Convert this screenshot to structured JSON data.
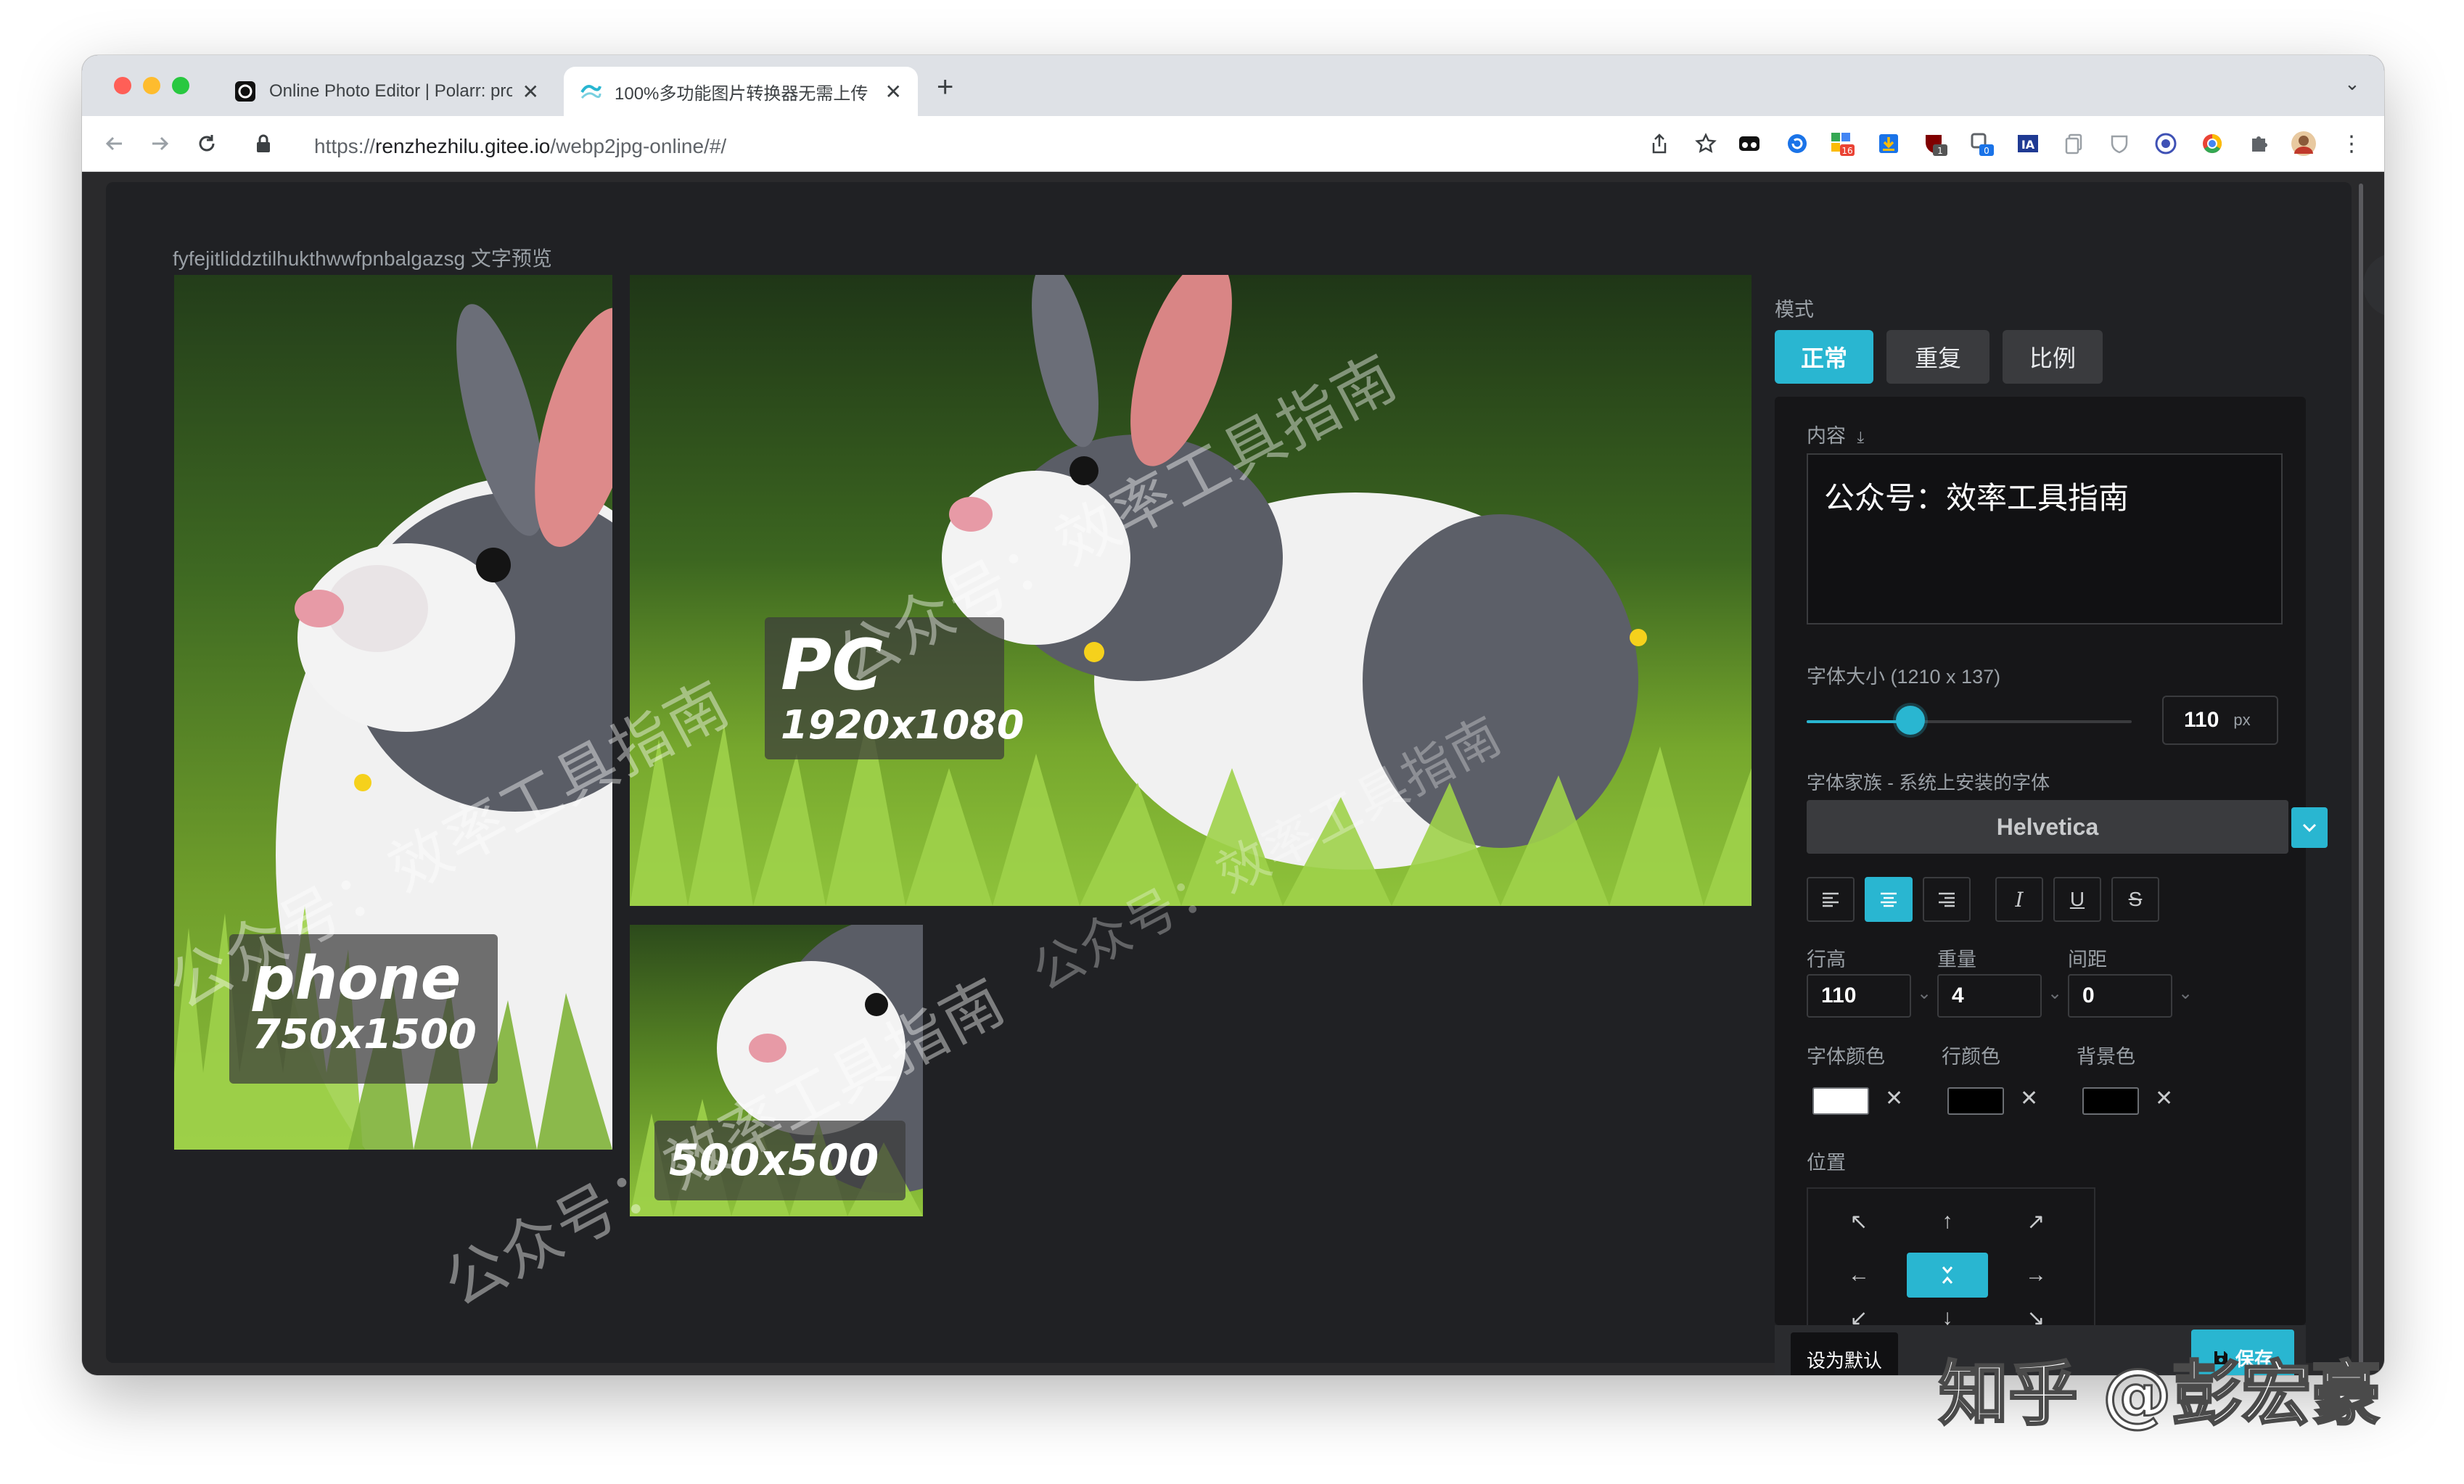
{
  "browser": {
    "tabs": [
      {
        "title": "Online Photo Editor | Polarr: pro",
        "active": false,
        "icon": "polarr-logo-icon"
      },
      {
        "title": "100%多功能图片转换器无需上传",
        "active": true,
        "icon": "converter-logo-icon"
      }
    ],
    "url_scheme": "https://",
    "url_host": "renzhezhilu.gitee.io",
    "url_path": "/webp2jpg-online/#/",
    "extension_badges": {
      "ext3": "16",
      "ext5": "1",
      "ext6": "0"
    }
  },
  "preview": {
    "label": "fyfejitliddztilhukthwwfpnbalgazsg 文字预览",
    "images": [
      {
        "name": "phone",
        "size": "750x1500"
      },
      {
        "name": "PC",
        "size": "1920x1080"
      },
      {
        "name": "",
        "size": "500x500"
      }
    ],
    "watermark_text": "公众号：效率工具指南"
  },
  "panel": {
    "mode_label": "模式",
    "modes": [
      "正常",
      "重复",
      "比例"
    ],
    "active_mode": 0,
    "content_label": "内容",
    "content_value": "公众号：效率工具指南",
    "font_size_label": "字体大小 (1210 x 137)",
    "font_size_value": "110",
    "font_size_unit": "px",
    "font_size_fraction": 0.32,
    "font_family_label": "字体家族 - 系统上安装的字体",
    "font_family_value": "Helvetica",
    "line_height_label": "行高",
    "line_height_value": "110",
    "weight_label": "重量",
    "weight_value": "4",
    "spacing_label": "间距",
    "spacing_value": "0",
    "font_color_label": "字体颜色",
    "line_color_label": "行颜色",
    "bg_color_label": "背景色",
    "font_color": "#ffffff",
    "line_color": "#000000",
    "bg_color": "#000000",
    "position_label": "位置",
    "set_default_label": "设为默认",
    "save_label": "保存"
  },
  "site_watermark": "知乎 @彭宏豪",
  "colors": {
    "accent": "#29b6d1",
    "panel_bg": "#161618",
    "modal_bg": "#202124"
  }
}
